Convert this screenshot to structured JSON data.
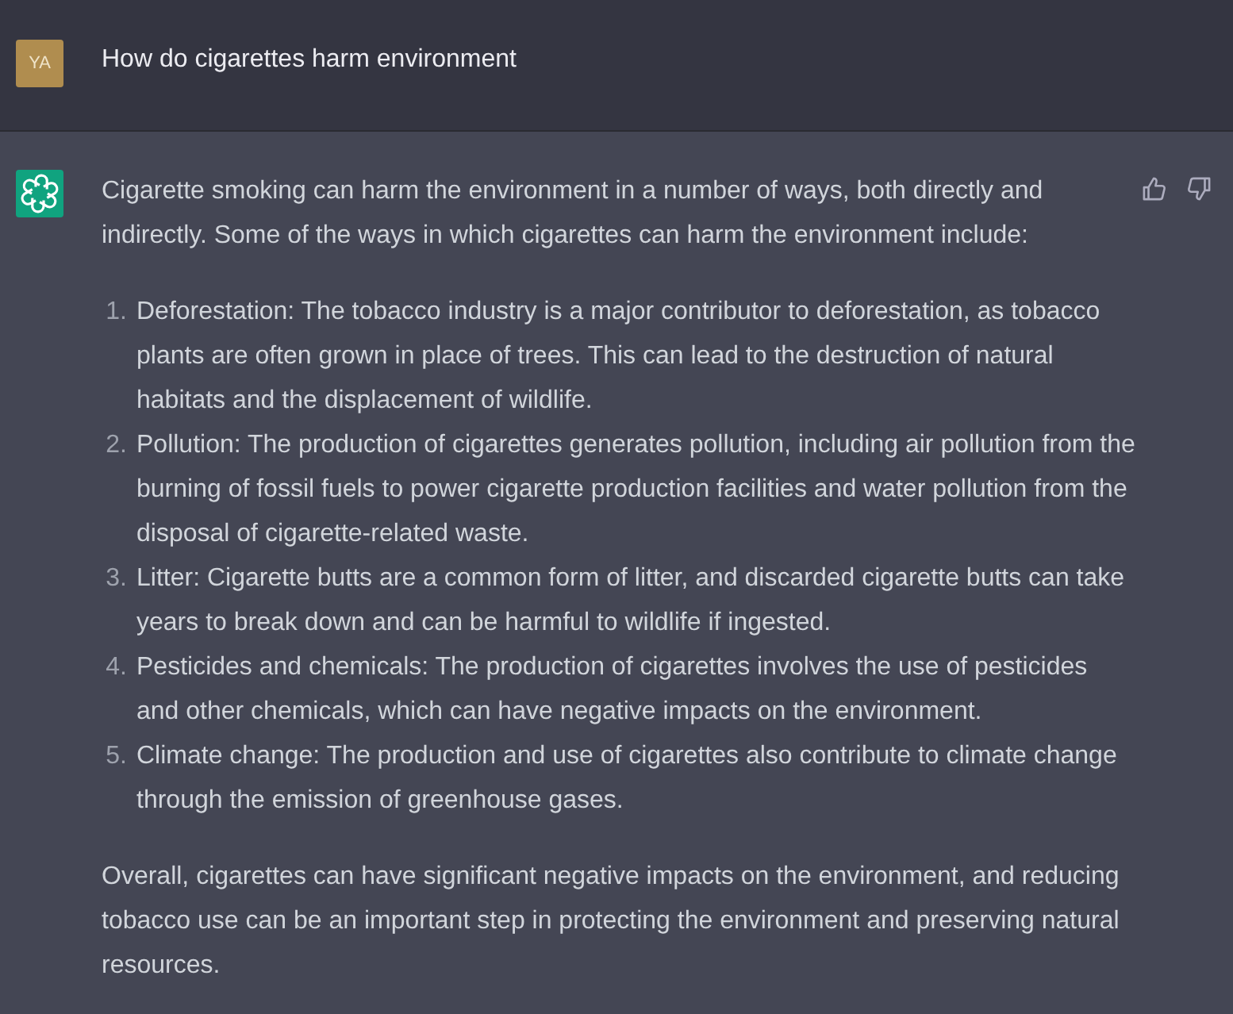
{
  "conversation": [
    {
      "kind": "user",
      "avatar_initials": "YA",
      "text": "How do cigarettes harm environment"
    },
    {
      "kind": "assistant",
      "intro": "Cigarette smoking can harm the environment in a number of ways, both directly and indirectly. Some of the ways in which cigarettes can harm the environment include:",
      "list": [
        {
          "number": "1.",
          "text": "Deforestation: The tobacco industry is a major contributor to deforestation, as tobacco plants are often grown in place of trees. This can lead to the destruction of natural habitats and the displacement of wildlife."
        },
        {
          "number": "2.",
          "text": "Pollution: The production of cigarettes generates pollution, including air pollution from the burning of fossil fuels to power cigarette production facilities and water pollution from the disposal of cigarette-related waste."
        },
        {
          "number": "3.",
          "text": "Litter: Cigarette butts are a common form of litter, and discarded cigarette butts can take years to break down and can be harmful to wildlife if ingested."
        },
        {
          "number": "4.",
          "text": "Pesticides and chemicals: The production of cigarettes involves the use of pesticides and other chemicals, which can have negative impacts on the environment."
        },
        {
          "number": "5.",
          "text": "Climate change: The production and use of cigarettes also contribute to climate change through the emission of greenhouse gases."
        }
      ],
      "outro": "Overall, cigarettes can have significant negative impacts on the environment, and reducing tobacco use can be an important step in protecting the environment and preserving natural resources."
    }
  ]
}
